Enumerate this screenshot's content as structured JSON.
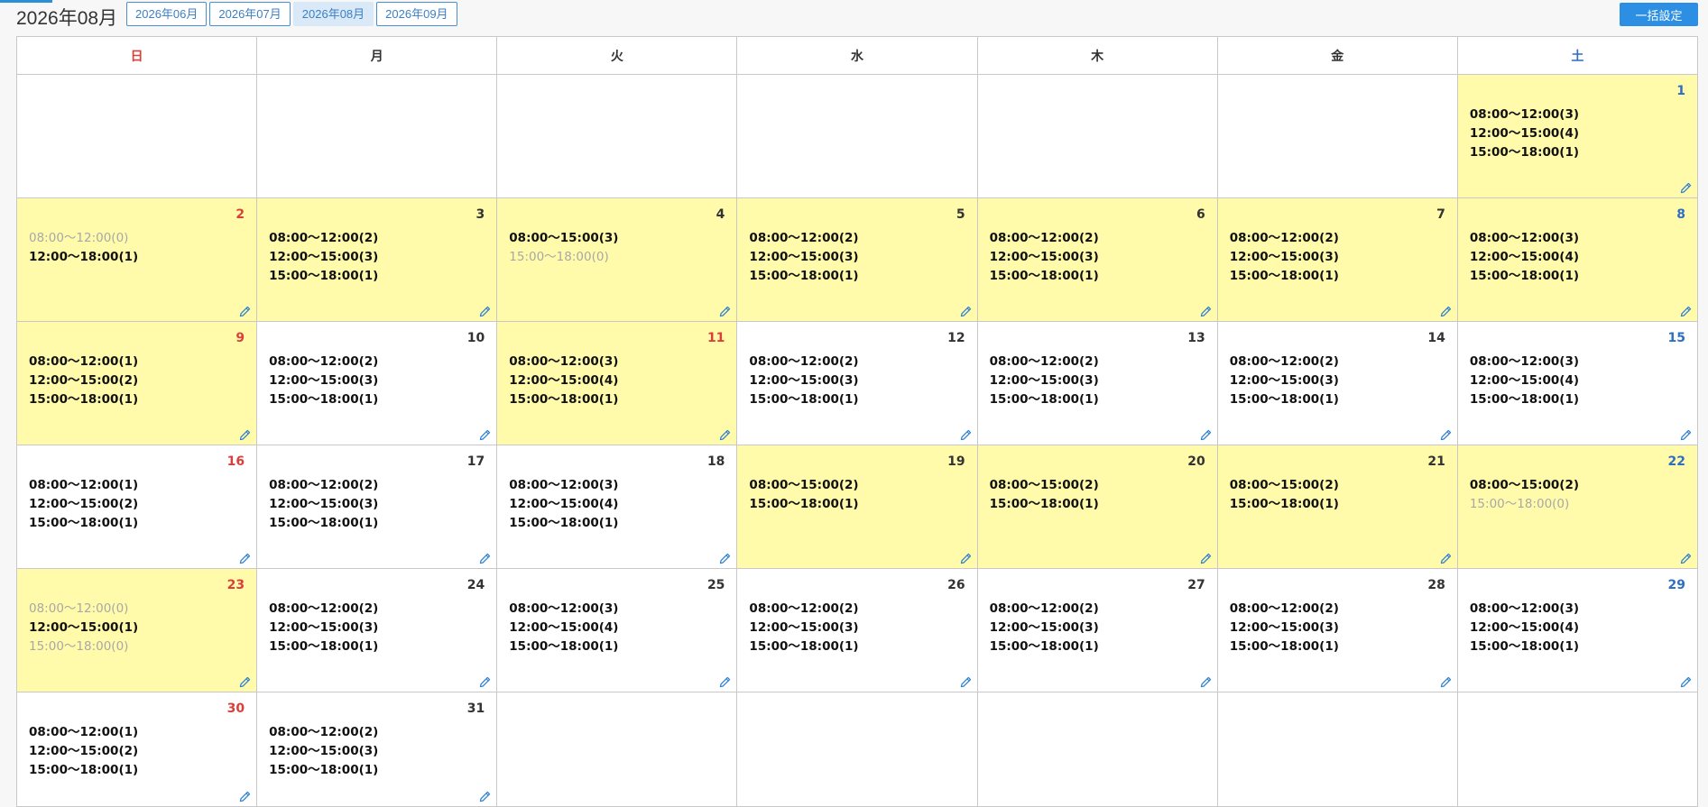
{
  "header": {
    "title": "2026年08月",
    "tabs": [
      "2026年06月",
      "2026年07月",
      "2026年08月",
      "2026年09月"
    ],
    "active_tab": 2,
    "bulk_button": "一括設定"
  },
  "calendar": {
    "weekdays": [
      "日",
      "月",
      "火",
      "水",
      "木",
      "金",
      "土"
    ],
    "weeks": [
      [
        null,
        null,
        null,
        null,
        null,
        null,
        {
          "day": "1",
          "highlight": true,
          "slots": [
            {
              "text": "08:00〜12:00(3)"
            },
            {
              "text": "12:00〜15:00(4)"
            },
            {
              "text": "15:00〜18:00(1)"
            }
          ]
        }
      ],
      [
        {
          "day": "2",
          "highlight": true,
          "slots": [
            {
              "text": "08:00〜12:00(0)",
              "dim": true
            },
            {
              "text": "12:00〜18:00(1)"
            }
          ]
        },
        {
          "day": "3",
          "highlight": true,
          "slots": [
            {
              "text": "08:00〜12:00(2)"
            },
            {
              "text": "12:00〜15:00(3)"
            },
            {
              "text": "15:00〜18:00(1)"
            }
          ]
        },
        {
          "day": "4",
          "highlight": true,
          "slots": [
            {
              "text": "08:00〜15:00(3)"
            },
            {
              "text": "15:00〜18:00(0)",
              "dim": true
            }
          ]
        },
        {
          "day": "5",
          "highlight": true,
          "slots": [
            {
              "text": "08:00〜12:00(2)"
            },
            {
              "text": "12:00〜15:00(3)"
            },
            {
              "text": "15:00〜18:00(1)"
            }
          ]
        },
        {
          "day": "6",
          "highlight": true,
          "slots": [
            {
              "text": "08:00〜12:00(2)"
            },
            {
              "text": "12:00〜15:00(3)"
            },
            {
              "text": "15:00〜18:00(1)"
            }
          ]
        },
        {
          "day": "7",
          "highlight": true,
          "slots": [
            {
              "text": "08:00〜12:00(2)"
            },
            {
              "text": "12:00〜15:00(3)"
            },
            {
              "text": "15:00〜18:00(1)"
            }
          ]
        },
        {
          "day": "8",
          "highlight": true,
          "slots": [
            {
              "text": "08:00〜12:00(3)"
            },
            {
              "text": "12:00〜15:00(4)"
            },
            {
              "text": "15:00〜18:00(1)"
            }
          ]
        }
      ],
      [
        {
          "day": "9",
          "highlight": true,
          "slots": [
            {
              "text": "08:00〜12:00(1)"
            },
            {
              "text": "12:00〜15:00(2)"
            },
            {
              "text": "15:00〜18:00(1)"
            }
          ]
        },
        {
          "day": "10",
          "highlight": false,
          "slots": [
            {
              "text": "08:00〜12:00(2)"
            },
            {
              "text": "12:00〜15:00(3)"
            },
            {
              "text": "15:00〜18:00(1)"
            }
          ]
        },
        {
          "day": "11",
          "highlight": true,
          "holiday": true,
          "slots": [
            {
              "text": "08:00〜12:00(3)"
            },
            {
              "text": "12:00〜15:00(4)"
            },
            {
              "text": "15:00〜18:00(1)"
            }
          ]
        },
        {
          "day": "12",
          "highlight": false,
          "slots": [
            {
              "text": "08:00〜12:00(2)"
            },
            {
              "text": "12:00〜15:00(3)"
            },
            {
              "text": "15:00〜18:00(1)"
            }
          ]
        },
        {
          "day": "13",
          "highlight": false,
          "slots": [
            {
              "text": "08:00〜12:00(2)"
            },
            {
              "text": "12:00〜15:00(3)"
            },
            {
              "text": "15:00〜18:00(1)"
            }
          ]
        },
        {
          "day": "14",
          "highlight": false,
          "slots": [
            {
              "text": "08:00〜12:00(2)"
            },
            {
              "text": "12:00〜15:00(3)"
            },
            {
              "text": "15:00〜18:00(1)"
            }
          ]
        },
        {
          "day": "15",
          "highlight": false,
          "slots": [
            {
              "text": "08:00〜12:00(3)"
            },
            {
              "text": "12:00〜15:00(4)"
            },
            {
              "text": "15:00〜18:00(1)"
            }
          ]
        }
      ],
      [
        {
          "day": "16",
          "highlight": false,
          "slots": [
            {
              "text": "08:00〜12:00(1)"
            },
            {
              "text": "12:00〜15:00(2)"
            },
            {
              "text": "15:00〜18:00(1)"
            }
          ]
        },
        {
          "day": "17",
          "highlight": false,
          "slots": [
            {
              "text": "08:00〜12:00(2)"
            },
            {
              "text": "12:00〜15:00(3)"
            },
            {
              "text": "15:00〜18:00(1)"
            }
          ]
        },
        {
          "day": "18",
          "highlight": false,
          "slots": [
            {
              "text": "08:00〜12:00(3)"
            },
            {
              "text": "12:00〜15:00(4)"
            },
            {
              "text": "15:00〜18:00(1)"
            }
          ]
        },
        {
          "day": "19",
          "highlight": true,
          "slots": [
            {
              "text": "08:00〜15:00(2)"
            },
            {
              "text": "15:00〜18:00(1)"
            }
          ]
        },
        {
          "day": "20",
          "highlight": true,
          "slots": [
            {
              "text": "08:00〜15:00(2)"
            },
            {
              "text": "15:00〜18:00(1)"
            }
          ]
        },
        {
          "day": "21",
          "highlight": true,
          "slots": [
            {
              "text": "08:00〜15:00(2)"
            },
            {
              "text": "15:00〜18:00(1)"
            }
          ]
        },
        {
          "day": "22",
          "highlight": true,
          "slots": [
            {
              "text": "08:00〜15:00(2)"
            },
            {
              "text": "15:00〜18:00(0)",
              "dim": true
            }
          ]
        }
      ],
      [
        {
          "day": "23",
          "highlight": true,
          "slots": [
            {
              "text": "08:00〜12:00(0)",
              "dim": true
            },
            {
              "text": "12:00〜15:00(1)"
            },
            {
              "text": "15:00〜18:00(0)",
              "dim": true
            }
          ]
        },
        {
          "day": "24",
          "highlight": false,
          "slots": [
            {
              "text": "08:00〜12:00(2)"
            },
            {
              "text": "12:00〜15:00(3)"
            },
            {
              "text": "15:00〜18:00(1)"
            }
          ]
        },
        {
          "day": "25",
          "highlight": false,
          "slots": [
            {
              "text": "08:00〜12:00(3)"
            },
            {
              "text": "12:00〜15:00(4)"
            },
            {
              "text": "15:00〜18:00(1)"
            }
          ]
        },
        {
          "day": "26",
          "highlight": false,
          "slots": [
            {
              "text": "08:00〜12:00(2)"
            },
            {
              "text": "12:00〜15:00(3)"
            },
            {
              "text": "15:00〜18:00(1)"
            }
          ]
        },
        {
          "day": "27",
          "highlight": false,
          "slots": [
            {
              "text": "08:00〜12:00(2)"
            },
            {
              "text": "12:00〜15:00(3)"
            },
            {
              "text": "15:00〜18:00(1)"
            }
          ]
        },
        {
          "day": "28",
          "highlight": false,
          "slots": [
            {
              "text": "08:00〜12:00(2)"
            },
            {
              "text": "12:00〜15:00(3)"
            },
            {
              "text": "15:00〜18:00(1)"
            }
          ]
        },
        {
          "day": "29",
          "highlight": false,
          "slots": [
            {
              "text": "08:00〜12:00(3)"
            },
            {
              "text": "12:00〜15:00(4)"
            },
            {
              "text": "15:00〜18:00(1)"
            }
          ]
        }
      ],
      [
        {
          "day": "30",
          "highlight": false,
          "slots": [
            {
              "text": "08:00〜12:00(1)"
            },
            {
              "text": "12:00〜15:00(2)"
            },
            {
              "text": "15:00〜18:00(1)"
            }
          ]
        },
        {
          "day": "31",
          "highlight": false,
          "slots": [
            {
              "text": "08:00〜12:00(2)"
            },
            {
              "text": "12:00〜15:00(3)"
            },
            {
              "text": "15:00〜18:00(1)"
            }
          ]
        },
        null,
        null,
        null,
        null,
        null
      ]
    ]
  },
  "icons": {
    "edit": "pencil-icon"
  },
  "colors": {
    "highlight_bg": "#fffbab",
    "sunday": "#d9403a",
    "saturday": "#2e6ec3",
    "accent": "#2d8fe4",
    "dim_text": "#a8a8a8"
  }
}
